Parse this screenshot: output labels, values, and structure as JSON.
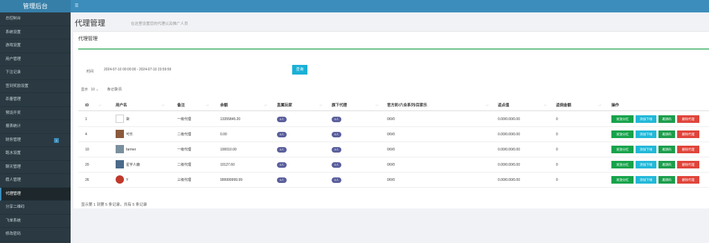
{
  "brand": "管理后台",
  "nav": [
    {
      "label": "总控制台"
    },
    {
      "label": "系统设置"
    },
    {
      "label": "游戏设置"
    },
    {
      "label": "用户管理"
    },
    {
      "label": "下注记录"
    },
    {
      "label": "签到奖励设置"
    },
    {
      "label": "杀量管理"
    },
    {
      "label": "预设开奖"
    },
    {
      "label": "报表统计"
    },
    {
      "label": "财务管理",
      "badge": "1"
    },
    {
      "label": "跑水设置"
    },
    {
      "label": "聊天管理"
    },
    {
      "label": "假人管理"
    },
    {
      "label": "代理管理",
      "active": true
    },
    {
      "label": "分享二维码"
    },
    {
      "label": "飞单系统"
    },
    {
      "label": "修改密码"
    }
  ],
  "topbar": {
    "toggle": "☰"
  },
  "page": {
    "title": "代理管理",
    "subtitle": "在这里设置您的代理以及推广人员"
  },
  "box": {
    "title": "代理管理"
  },
  "filter": {
    "label": "时间",
    "range": "2024-07-10 00:00:00 - 2024-07-10 23:59:59",
    "query_label": "查询"
  },
  "pagesize": {
    "prefix": "显示",
    "value": "10",
    "suffix": "条记录/页"
  },
  "table": {
    "columns": [
      "ID",
      "用户名",
      "备注",
      "余额",
      "直属玩家",
      "旗下代理",
      "官方彩/六合系列/百家乐",
      "返点值",
      "返佣金额",
      "操作"
    ],
    "rows": [
      {
        "id": "1",
        "name": "柒",
        "note": "一级代理",
        "balance": "13355845.20",
        "direct": "0人",
        "sub": "0人",
        "official": "0/0/0",
        "rebate": "0.00/0.00/0.00",
        "commission": "0",
        "avatar": "blank"
      },
      {
        "id": "4",
        "name": "可乐",
        "note": "二级代理",
        "balance": "0.00",
        "direct": "0人",
        "sub": "0人",
        "official": "0/0/0",
        "rebate": "0.00/0.00/0.00",
        "commission": "0",
        "avatar": "dark"
      },
      {
        "id": "10",
        "name": "farmer",
        "note": "一级代理",
        "balance": "100010.00",
        "direct": "0人",
        "sub": "0人",
        "official": "0/0/0",
        "rebate": "0.00/0.00/0.00",
        "commission": "0",
        "avatar": "dark3"
      },
      {
        "id": "20",
        "name": "星宇人鹿",
        "note": "二级代理",
        "balance": "10127.60",
        "direct": "0人",
        "sub": "0人",
        "official": "0/0/0",
        "rebate": "0.00/0.00/0.00",
        "commission": "0",
        "avatar": "dark2"
      },
      {
        "id": "26",
        "name": "Y",
        "note": "三级代理",
        "balance": "999999999.99",
        "direct": "0人",
        "sub": "0人",
        "official": "0/0/0",
        "rebate": "0.00/0.00/0.00",
        "commission": "0",
        "avatar": "red"
      }
    ],
    "actions": [
      "发放分红",
      "添加下线",
      "邀请码",
      "删除代理"
    ]
  },
  "footer": {
    "info": "显示第 1 到第 5 条记录，共有 5 条记录"
  }
}
